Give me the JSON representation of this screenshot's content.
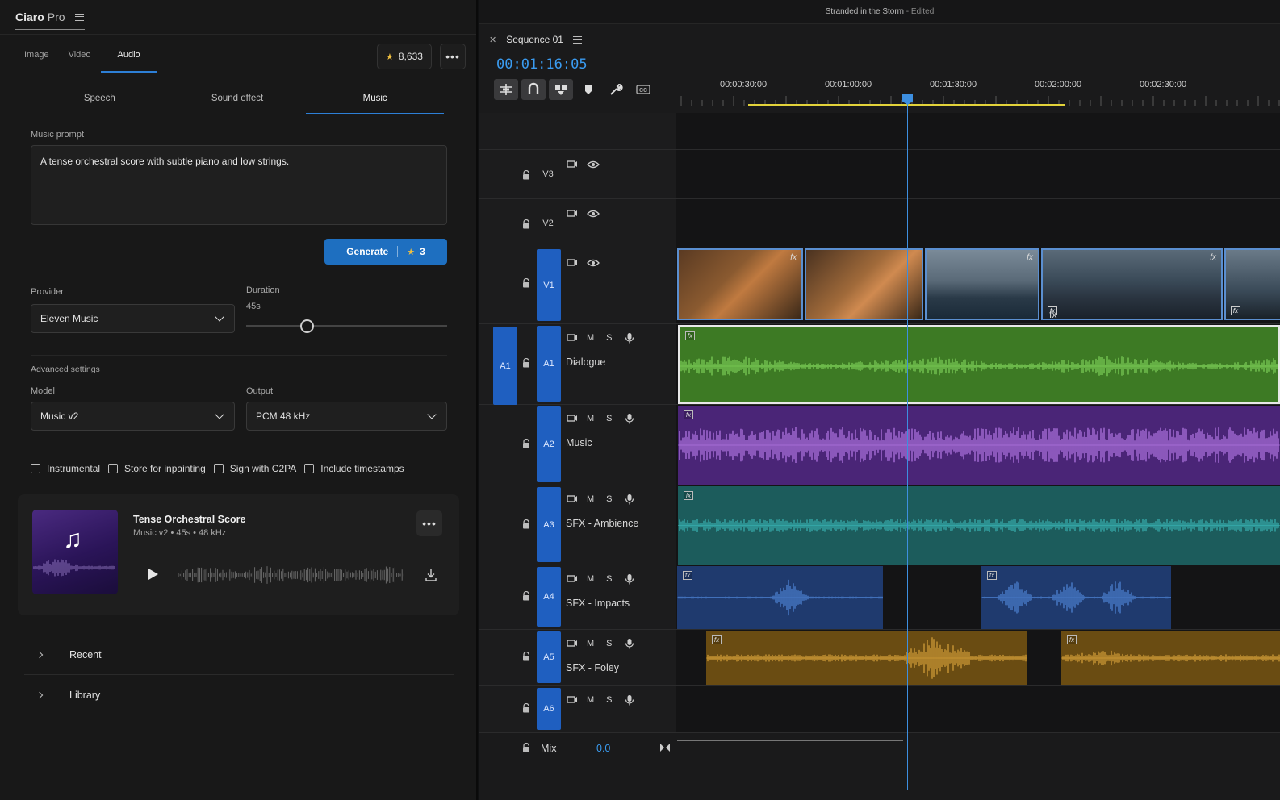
{
  "app": {
    "brand": "Ciaro",
    "brand_suffix": "Pro"
  },
  "media_tabs": [
    "Image",
    "Video",
    "Audio"
  ],
  "media_tab_active": "Audio",
  "credits": "8,633",
  "sub_tabs": [
    "Speech",
    "Sound effect",
    "Music"
  ],
  "sub_tab_active": "Music",
  "prompt": {
    "label": "Music prompt",
    "value": "A tense orchestral score with subtle piano and low strings."
  },
  "generate": {
    "label": "Generate",
    "cost": "3"
  },
  "provider": {
    "label": "Provider",
    "value": "Eleven Music"
  },
  "duration": {
    "label": "Duration",
    "value": "45s",
    "fraction": 0.3
  },
  "advanced": {
    "label": "Advanced settings"
  },
  "model": {
    "label": "Model",
    "value": "Music v2"
  },
  "output": {
    "label": "Output",
    "value": "PCM 48 kHz"
  },
  "checkboxes": [
    "Instrumental",
    "Store for inpainting",
    "Sign with C2PA",
    "Include timestamps"
  ],
  "result": {
    "title": "Tense Orchestral Score",
    "subtitle": "Music v2  •  45s  •  48 kHz"
  },
  "accordions": [
    "Recent",
    "Library"
  ],
  "editor": {
    "project_title": "Stranded in the Storm",
    "edited": " - Edited",
    "sequence": "Sequence 01",
    "timecode": "00:01:16:05",
    "ruler": [
      "00:00:30:00",
      "00:01:00:00",
      "00:01:30:00",
      "00:02:00:00",
      "00:02:30:00"
    ],
    "source_patch": "A1",
    "video_tracks": [
      "V3",
      "V2",
      "V1"
    ],
    "audio_tracks": [
      {
        "id": "A1",
        "name": "Dialogue",
        "color": "#3d7a24",
        "wave": "#7fd25a"
      },
      {
        "id": "A2",
        "name": "Music",
        "color": "#4a2577",
        "wave": "#b77ae8"
      },
      {
        "id": "A3",
        "name": "SFX - Ambience",
        "color": "#1c5c5c",
        "wave": "#39b3b3"
      },
      {
        "id": "A4",
        "name": "SFX - Impacts",
        "color": "#1f3a6e",
        "wave": "#4f86d8"
      },
      {
        "id": "A5",
        "name": "SFX - Foley",
        "color": "#6a4c12",
        "wave": "#d8a23a"
      },
      {
        "id": "A6",
        "name": "",
        "color": "",
        "wave": ""
      }
    ],
    "mute_label": "M",
    "solo_label": "S",
    "mix": {
      "label": "Mix",
      "value": "0.0"
    }
  }
}
